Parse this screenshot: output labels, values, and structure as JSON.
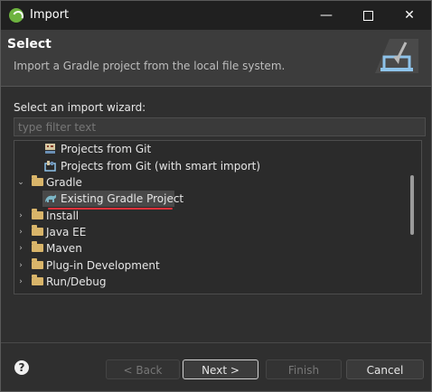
{
  "window": {
    "title": "Import",
    "minimize_glyph": "—",
    "close_glyph": "✕",
    "icon": "spring-icon"
  },
  "banner": {
    "heading": "Select",
    "description": "Import a Gradle project from the local file system.",
    "icon": "import-wizard-icon"
  },
  "wizard": {
    "label": "Select an import wizard:",
    "filter_placeholder": "type filter text"
  },
  "tree": {
    "items": [
      {
        "label": "Projects from Git",
        "level": 1,
        "icon": "git-icon"
      },
      {
        "label": "Projects from Git (with smart import)",
        "level": 1,
        "icon": "git-smart-icon"
      },
      {
        "label": "Gradle",
        "level": 0,
        "expanded": true,
        "icon": "folder-icon"
      },
      {
        "label": "Existing Gradle Project",
        "level": 1,
        "icon": "gradle-icon",
        "selected": true
      },
      {
        "label": "Install",
        "level": 0,
        "expanded": false,
        "icon": "folder-icon"
      },
      {
        "label": "Java EE",
        "level": 0,
        "expanded": false,
        "icon": "folder-icon"
      },
      {
        "label": "Maven",
        "level": 0,
        "expanded": false,
        "icon": "folder-icon"
      },
      {
        "label": "Plug-in Development",
        "level": 0,
        "expanded": false,
        "icon": "folder-icon"
      },
      {
        "label": "Run/Debug",
        "level": 0,
        "expanded": false,
        "icon": "folder-icon"
      }
    ]
  },
  "buttons": {
    "help": "?",
    "back": "< Back",
    "next": "Next >",
    "finish": "Finish",
    "cancel": "Cancel"
  },
  "colors": {
    "selection_underline": "#e0323b",
    "accent": "#6db33f"
  }
}
